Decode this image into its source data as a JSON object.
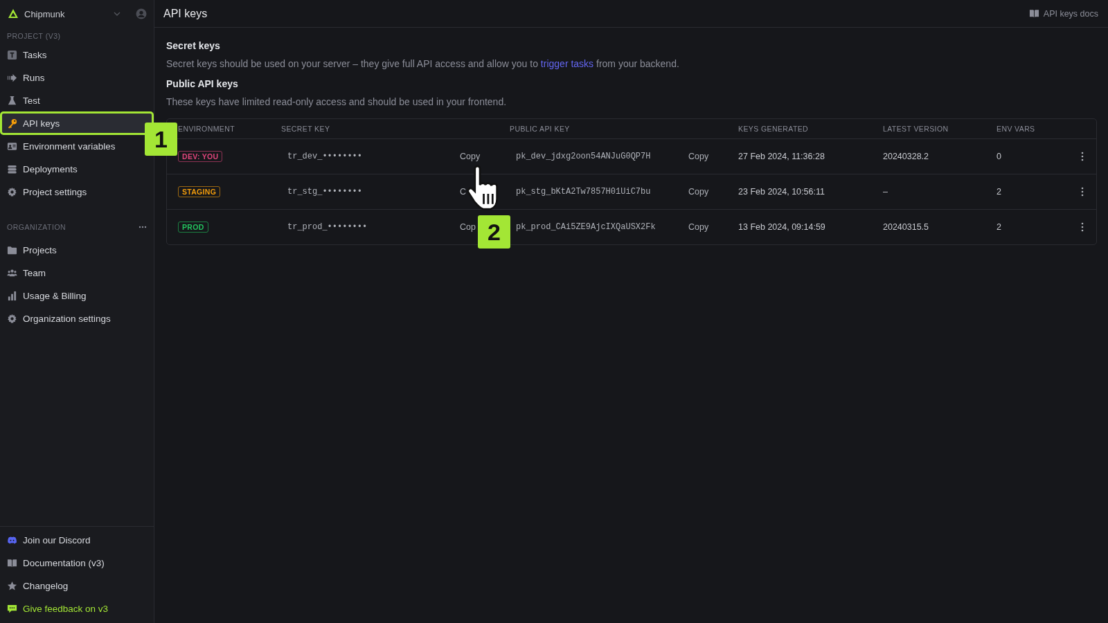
{
  "sidebar": {
    "org": "Chipmunk",
    "sections": [
      {
        "title": "PROJECT (V3)",
        "more": false,
        "items": [
          {
            "label": "Tasks",
            "selected": false,
            "highlighted": false
          },
          {
            "label": "Runs",
            "selected": false,
            "highlighted": false
          },
          {
            "label": "Test",
            "selected": false,
            "highlighted": false
          },
          {
            "label": "API keys",
            "selected": true,
            "highlighted": true
          },
          {
            "label": "Environment variables",
            "selected": false,
            "highlighted": false
          },
          {
            "label": "Deployments",
            "selected": false,
            "highlighted": false
          },
          {
            "label": "Project settings",
            "selected": false,
            "highlighted": false
          }
        ]
      },
      {
        "title": "ORGANIZATION",
        "more": true,
        "items": [
          {
            "label": "Projects",
            "selected": false,
            "highlighted": false
          },
          {
            "label": "Team",
            "selected": false,
            "highlighted": false
          },
          {
            "label": "Usage & Billing",
            "selected": false,
            "highlighted": false
          },
          {
            "label": "Organization settings",
            "selected": false,
            "highlighted": false
          }
        ]
      }
    ],
    "footer": [
      {
        "label": "Join our Discord",
        "accent": false
      },
      {
        "label": "Documentation (v3)",
        "accent": false
      },
      {
        "label": "Changelog",
        "accent": false
      },
      {
        "label": "Give feedback on v3",
        "accent": true
      }
    ]
  },
  "header": {
    "title": "API keys",
    "docs_link": "API keys docs"
  },
  "intro": [
    {
      "heading": "Secret keys",
      "text": "Secret keys should be used on your server – they give full API access and allow you to ",
      "link": "trigger tasks",
      "after": " from your backend."
    },
    {
      "heading": "Public API keys",
      "text": "These keys have limited read-only access and should be used in your frontend."
    }
  ],
  "table": {
    "columns": [
      "ENVIRONMENT",
      "SECRET KEY",
      "PUBLIC API KEY",
      "KEYS GENERATED",
      "LATEST VERSION",
      "ENV VARS"
    ],
    "rows": [
      {
        "environment": "DEV: YOU",
        "color": "#e0457b",
        "secret_key": "tr_dev_••••••••",
        "copy_secret": "Copy",
        "public_key": "pk_dev_jdxg2oon54ANJuG0QP7H",
        "copy_public": "Copy",
        "keys_generated": "27 Feb 2024, 11:36:28",
        "latest_version": "20240328.2",
        "env_vars": "0"
      },
      {
        "environment": "STAGING",
        "color": "#f59e0b",
        "secret_key": "tr_stg_••••••••",
        "copy_secret": "C",
        "public_key": "pk_stg_bKtA2Tw7857H01UiC7bu",
        "copy_public": "Copy",
        "keys_generated": "23 Feb 2024, 10:56:11",
        "latest_version": "–",
        "env_vars": "2"
      },
      {
        "environment": "PROD",
        "color": "#22c55e",
        "secret_key": "tr_prod_••••••••",
        "copy_secret": "Cop",
        "public_key": "pk_prod_CAi5ZE9AjcIXQaUSX2Fk",
        "copy_public": "Copy",
        "keys_generated": "13 Feb 2024, 09:14:59",
        "latest_version": "20240315.5",
        "env_vars": "2"
      }
    ]
  },
  "annotations": [
    {
      "label": "1"
    },
    {
      "label": "2"
    }
  ]
}
